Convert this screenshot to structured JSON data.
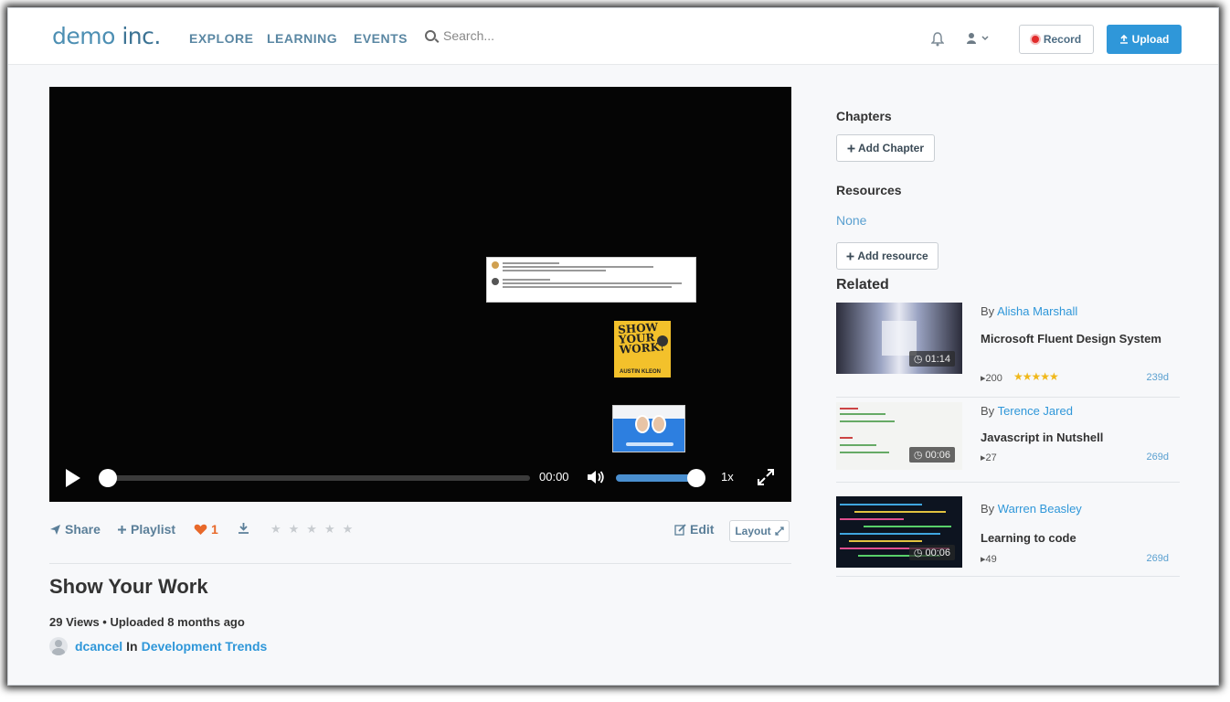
{
  "header": {
    "logo_main": "demo",
    "logo_suffix": " inc.",
    "nav": [
      "EXPLORE",
      "LEARNING",
      "EVENTS"
    ],
    "search_placeholder": "Search...",
    "record_label": "Record",
    "upload_label": "Upload"
  },
  "player": {
    "time": "00:00",
    "speed": "1x",
    "book_title": "SHOW YOUR WORK!",
    "book_author": "AUSTIN KLEON"
  },
  "actions": {
    "share": "Share",
    "playlist": "Playlist",
    "likes": "1",
    "rating_stars": "★★★★★",
    "edit": "Edit",
    "layout": "Layout"
  },
  "video": {
    "title": "Show Your Work",
    "meta": "29 Views • Uploaded 8 months ago",
    "owner": "dcancel",
    "in_label": "In",
    "category": "Development Trends"
  },
  "sidebar": {
    "chapters_heading": "Chapters",
    "add_chapter": "Add Chapter",
    "resources_heading": "Resources",
    "resources_none": "None",
    "add_resource": "Add resource",
    "related_heading": "Related"
  },
  "related": [
    {
      "by": "By",
      "author": "Alisha Marshall",
      "title": "Microsoft Fluent Design System",
      "duration": "01:14",
      "views": "200",
      "stars": "★★★★★",
      "age": "239d"
    },
    {
      "by": "By",
      "author": "Terence Jared",
      "title": "Javascript in Nutshell",
      "duration": "00:06",
      "views": "27",
      "stars": "",
      "age": "269d"
    },
    {
      "by": "By",
      "author": "Warren Beasley",
      "title": "Learning to code",
      "duration": "00:06",
      "views": "49",
      "stars": "",
      "age": "269d"
    }
  ]
}
